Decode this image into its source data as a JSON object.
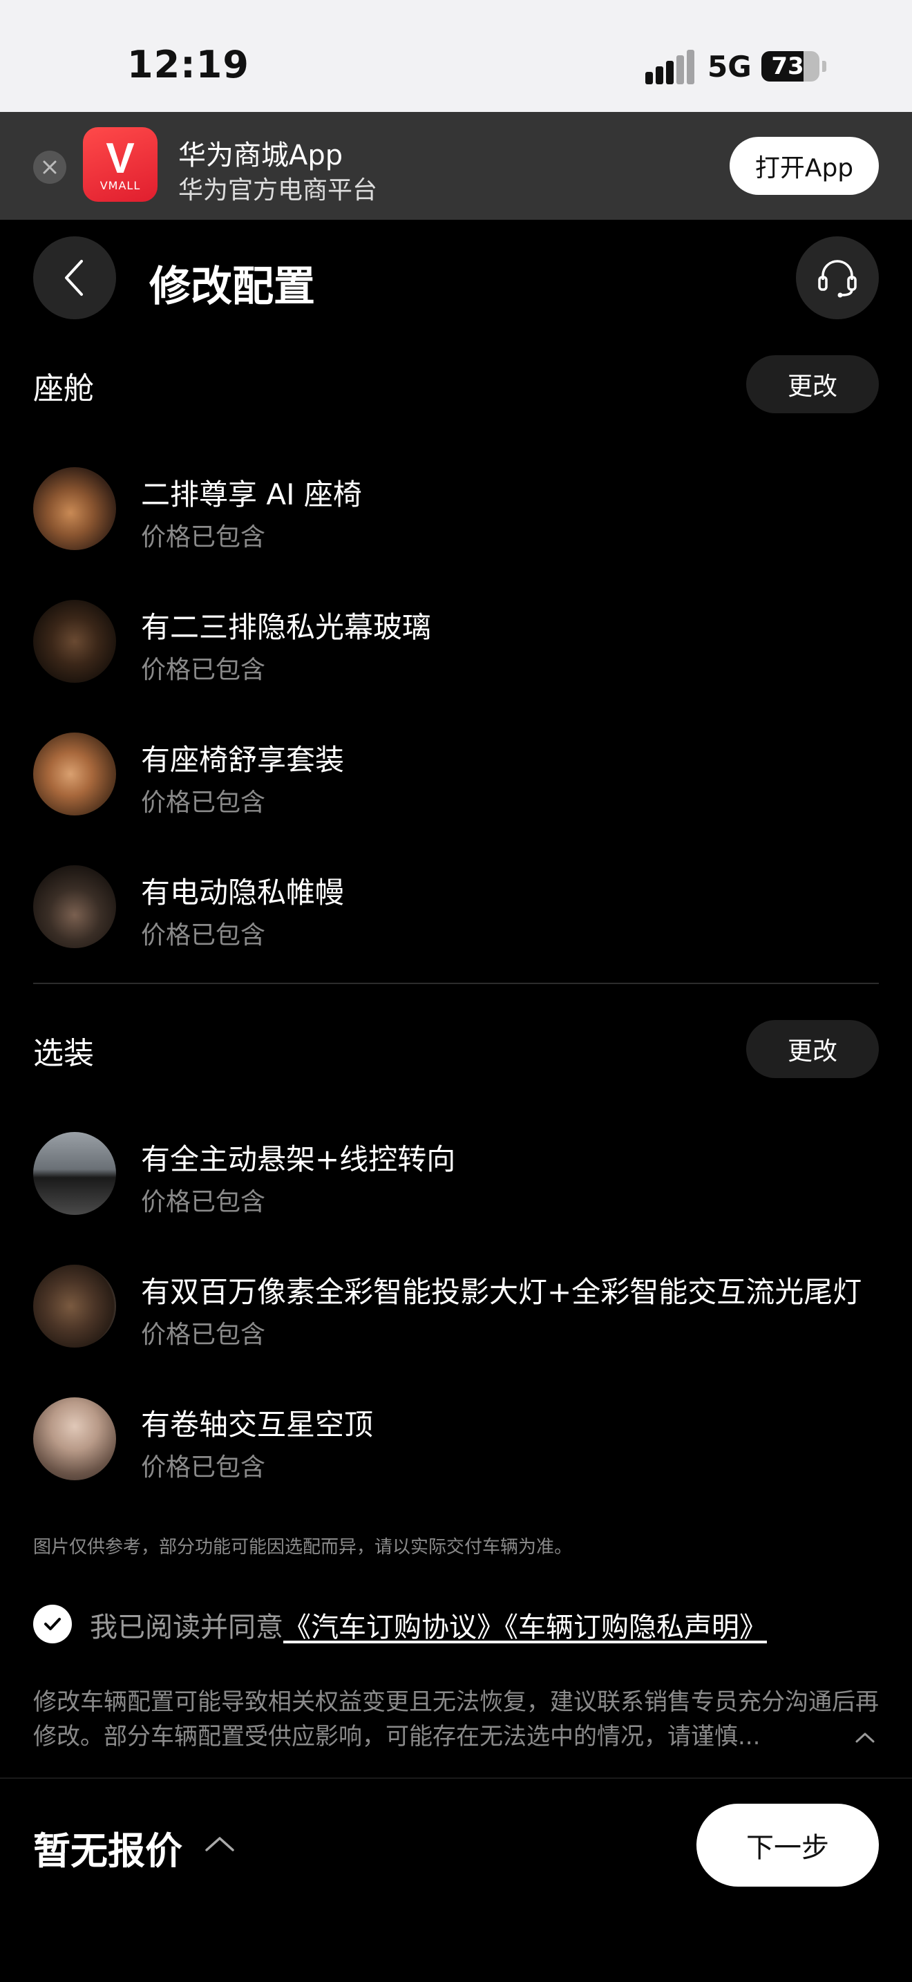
{
  "status_bar": {
    "time": "12:19",
    "network": "5G",
    "battery": "73",
    "battery_level": 0.73
  },
  "app_banner": {
    "app_name": "华为商城App",
    "subtitle": "华为官方电商平台",
    "logo_text": "V",
    "logo_subtext": "VMALL",
    "open_label": "打开App"
  },
  "header": {
    "title": "修改配置"
  },
  "cabin": {
    "title": "座舱",
    "change_label": "更改",
    "items": [
      {
        "name": "二排尊享 AI 座椅",
        "status": "价格已包含"
      },
      {
        "name": "有二三排隐私光幕玻璃",
        "status": "价格已包含"
      },
      {
        "name": "有座椅舒享套装",
        "status": "价格已包含"
      },
      {
        "name": "有电动隐私帷幔",
        "status": "价格已包含"
      }
    ]
  },
  "options": {
    "title": "选装",
    "change_label": "更改",
    "items": [
      {
        "name": "有全主动悬架+线控转向",
        "status": "价格已包含"
      },
      {
        "name": "有双百万像素全彩智能投影大灯+全彩智能交互流光尾灯",
        "status": "价格已包含"
      },
      {
        "name": "有卷轴交互星空顶",
        "status": "价格已包含"
      }
    ]
  },
  "disclaimer": "图片仅供参考，部分功能可能因选配而异，请以实际交付车辆为准。",
  "agreement": {
    "prefix": "我已阅读并同意",
    "link1": "《汽车订购协议》",
    "link2": "《车辆订购隐私声明》"
  },
  "notice": "修改车辆配置可能导致相关权益变更且无法恢复，建议联系销售专员充分沟通后再修改。部分车辆配置受供应影响，可能存在无法选中的情况，请谨慎...",
  "bottom": {
    "price": "暂无报价",
    "next_label": "下一步"
  },
  "colors": {
    "background": "#000000",
    "status_bar": "#f2f2f4",
    "banner": "#353535",
    "brand_red": "#e01e2e",
    "muted_text": "#8a8a8a"
  },
  "icons": [
    "close-icon",
    "vmall-logo",
    "chevron-left-icon",
    "headset-icon",
    "checkmark-icon",
    "chevron-up-icon"
  ]
}
